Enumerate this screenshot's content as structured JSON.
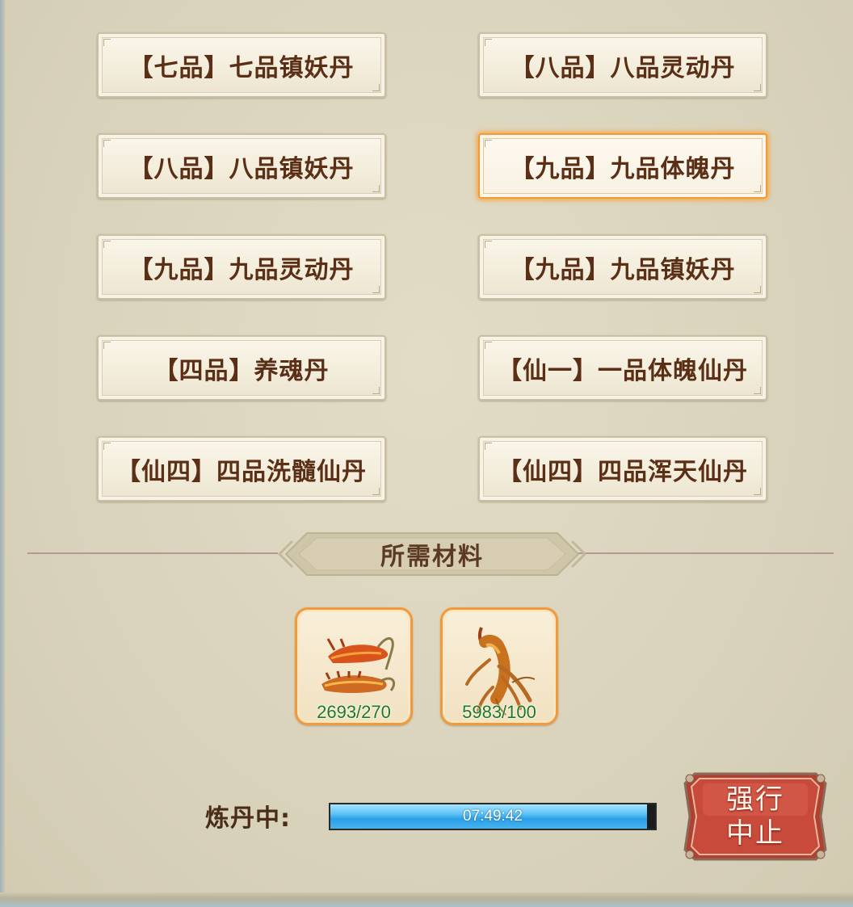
{
  "recipes": [
    {
      "label": "【七品】七品镇妖丹",
      "selected": false
    },
    {
      "label": "【八品】八品灵动丹",
      "selected": false
    },
    {
      "label": "【八品】八品镇妖丹",
      "selected": false
    },
    {
      "label": "【九品】九品体魄丹",
      "selected": true
    },
    {
      "label": "【九品】九品灵动丹",
      "selected": false
    },
    {
      "label": "【九品】九品镇妖丹",
      "selected": false
    },
    {
      "label": "【四品】养魂丹",
      "selected": false
    },
    {
      "label": "【仙一】一品体魄仙丹",
      "selected": false
    },
    {
      "label": "【仙四】四品洗髓仙丹",
      "selected": false
    },
    {
      "label": "【仙四】四品浑天仙丹",
      "selected": false
    }
  ],
  "materials": {
    "title": "所需材料",
    "items": [
      {
        "icon": "cordyceps-herb-icon",
        "count": "2693/270"
      },
      {
        "icon": "ginseng-root-icon",
        "count": "5983/100"
      }
    ]
  },
  "progress": {
    "label": "炼丹中:",
    "time": "07:49:42",
    "fraction": 0.975
  },
  "stop_button": {
    "label": "强行\n中止"
  },
  "colors": {
    "accent": "#f39a36",
    "text_brown": "#5a2f16",
    "count_green": "#1e7a1e",
    "progress_blue": "#2a9fe8",
    "button_red": "#c8443a"
  }
}
